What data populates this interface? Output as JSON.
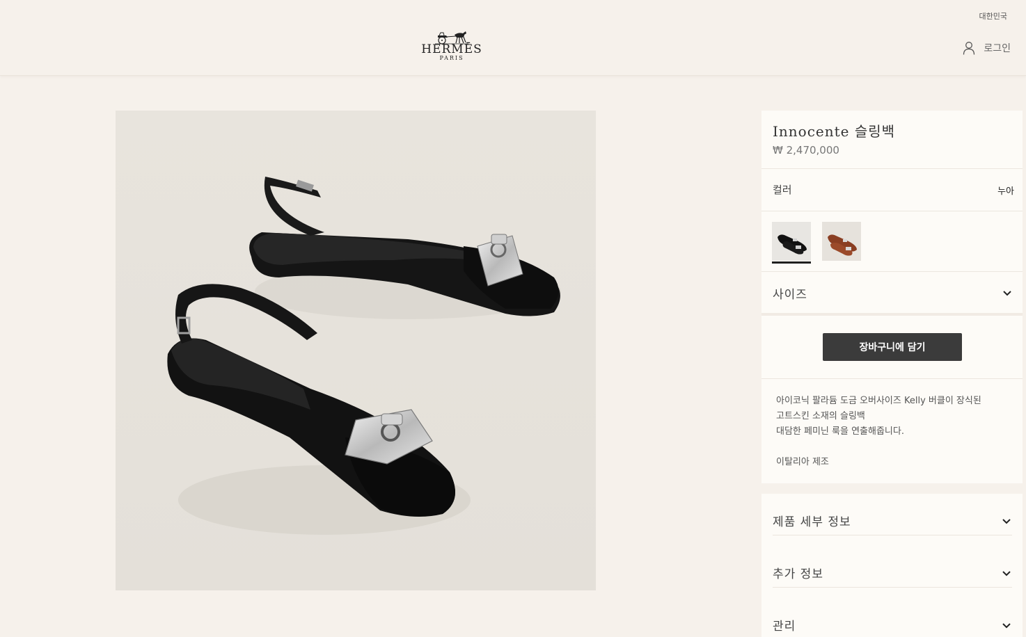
{
  "header": {
    "region": "대한민국",
    "logo_word": "HERMĒS",
    "logo_sub": "PARIS",
    "login_label": "로그인"
  },
  "product": {
    "title": "Innocente 슬링백",
    "price": "₩ 2,470,000",
    "color_label": "컬러",
    "color_value": "누아",
    "swatches": [
      {
        "name": "black",
        "selected": true
      },
      {
        "name": "brown",
        "selected": false
      }
    ],
    "size_label": "사이즈",
    "add_to_cart": "장바구니에 담기",
    "description_lines": [
      "아이코닉 팔라듐 도금 오버사이즈 Kelly 버클이 장식된",
      "고트스킨 소재의 슬링백",
      "대담한 페미닌 룩을 연출해줍니다."
    ],
    "made_in": "이탈리아 제조"
  },
  "accordion": {
    "details": "제품 세부 정보",
    "additional": "추가 정보",
    "care": "관리"
  },
  "colors": {
    "background": "#f6f1eb",
    "panel": "#fdfbf7",
    "button": "#3b3b3b"
  }
}
